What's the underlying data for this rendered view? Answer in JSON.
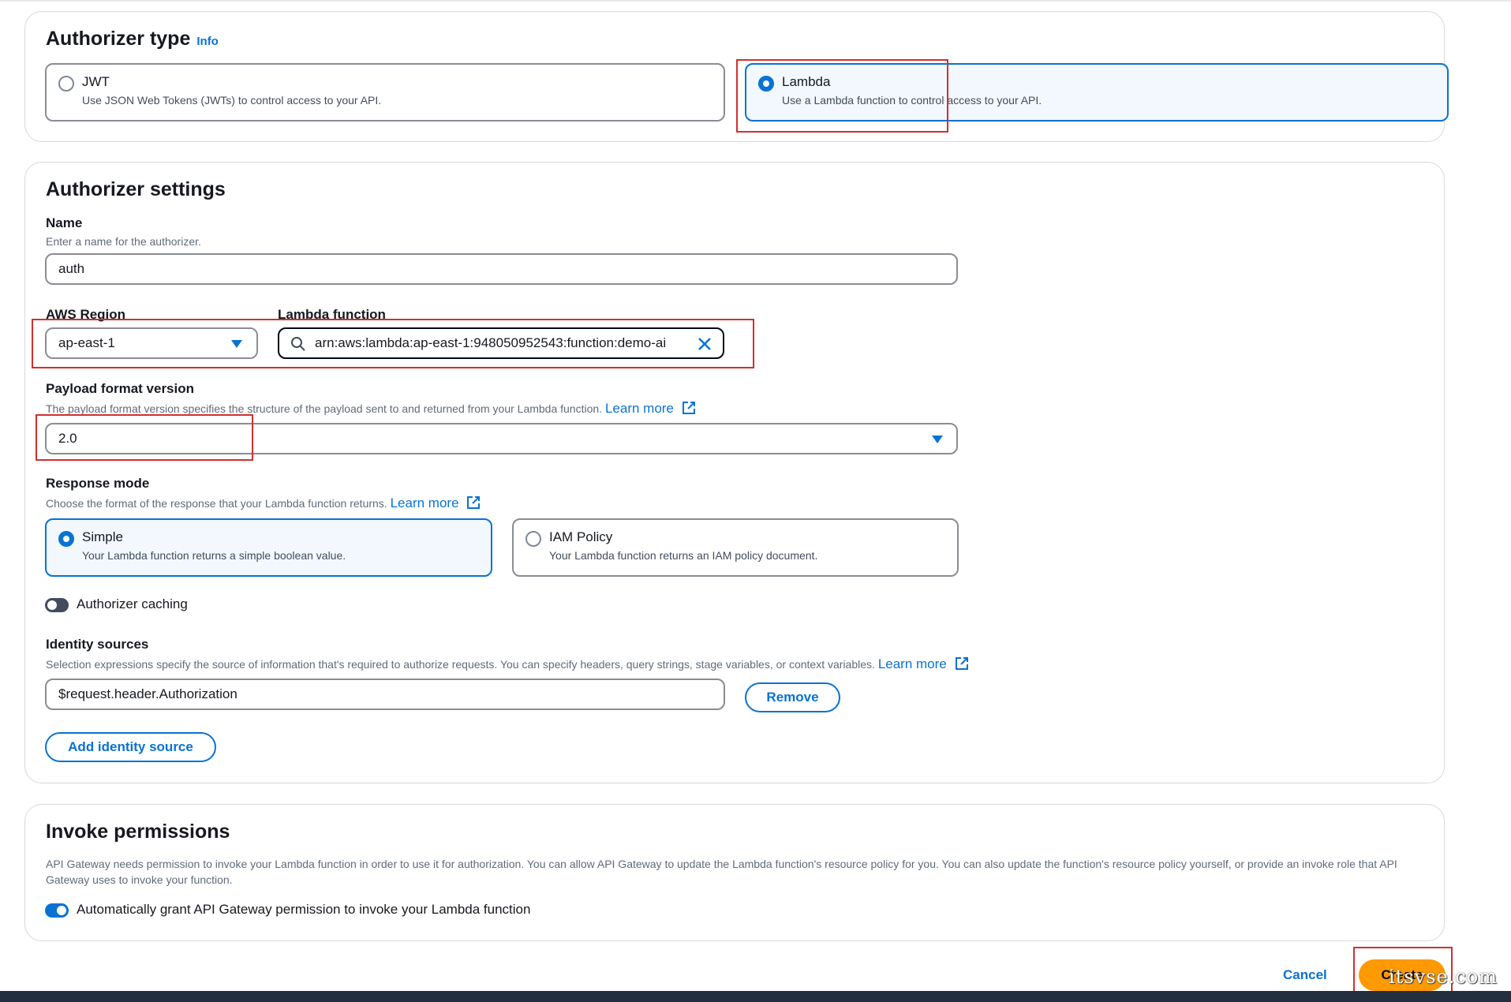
{
  "authorizer_type": {
    "title": "Authorizer type",
    "info": "Info",
    "options": [
      {
        "title": "JWT",
        "description": "Use JSON Web Tokens (JWTs) to control access to your API.",
        "selected": false
      },
      {
        "title": "Lambda",
        "description": "Use a Lambda function to control access to your API.",
        "selected": true
      }
    ]
  },
  "settings": {
    "title": "Authorizer settings",
    "name": {
      "label": "Name",
      "description": "Enter a name for the authorizer.",
      "value": "auth"
    },
    "region": {
      "label": "AWS Region",
      "value": "ap-east-1"
    },
    "lambda": {
      "label": "Lambda function",
      "value": "arn:aws:lambda:ap-east-1:948050952543:function:demo-ai"
    },
    "payload": {
      "label": "Payload format version",
      "description": "The payload format version specifies the structure of the payload sent to and returned from your Lambda function.",
      "learn_more": "Learn more",
      "value": "2.0"
    },
    "response": {
      "label": "Response mode",
      "description": "Choose the format of the response that your Lambda function returns.",
      "learn_more": "Learn more",
      "options": [
        {
          "title": "Simple",
          "description": "Your Lambda function returns a simple boolean value.",
          "selected": true
        },
        {
          "title": "IAM Policy",
          "description": "Your Lambda function returns an IAM policy document.",
          "selected": false
        }
      ]
    },
    "caching": {
      "label": "Authorizer caching",
      "enabled": false
    },
    "identity": {
      "label": "Identity sources",
      "description": "Selection expressions specify the source of information that's required to authorize requests. You can specify headers, query strings, stage variables, or context variables.",
      "learn_more": "Learn more",
      "value": "$request.header.Authorization",
      "remove_label": "Remove",
      "add_label": "Add identity source"
    }
  },
  "invoke": {
    "title": "Invoke permissions",
    "description": "API Gateway needs permission to invoke your Lambda function in order to use it for authorization. You can allow API Gateway to update the Lambda function's resource policy for you. You can also update the function's resource policy yourself, or provide an invoke role that API Gateway uses to invoke your function.",
    "auto_grant": {
      "label": "Automatically grant API Gateway permission to invoke your Lambda function",
      "enabled": true
    }
  },
  "footer": {
    "cancel_label": "Cancel",
    "create_label": "Create"
  },
  "watermark": "itsvse.com",
  "colors": {
    "accent": "#0972d3",
    "create": "#ff9900",
    "highlight": "#d32f2f"
  }
}
